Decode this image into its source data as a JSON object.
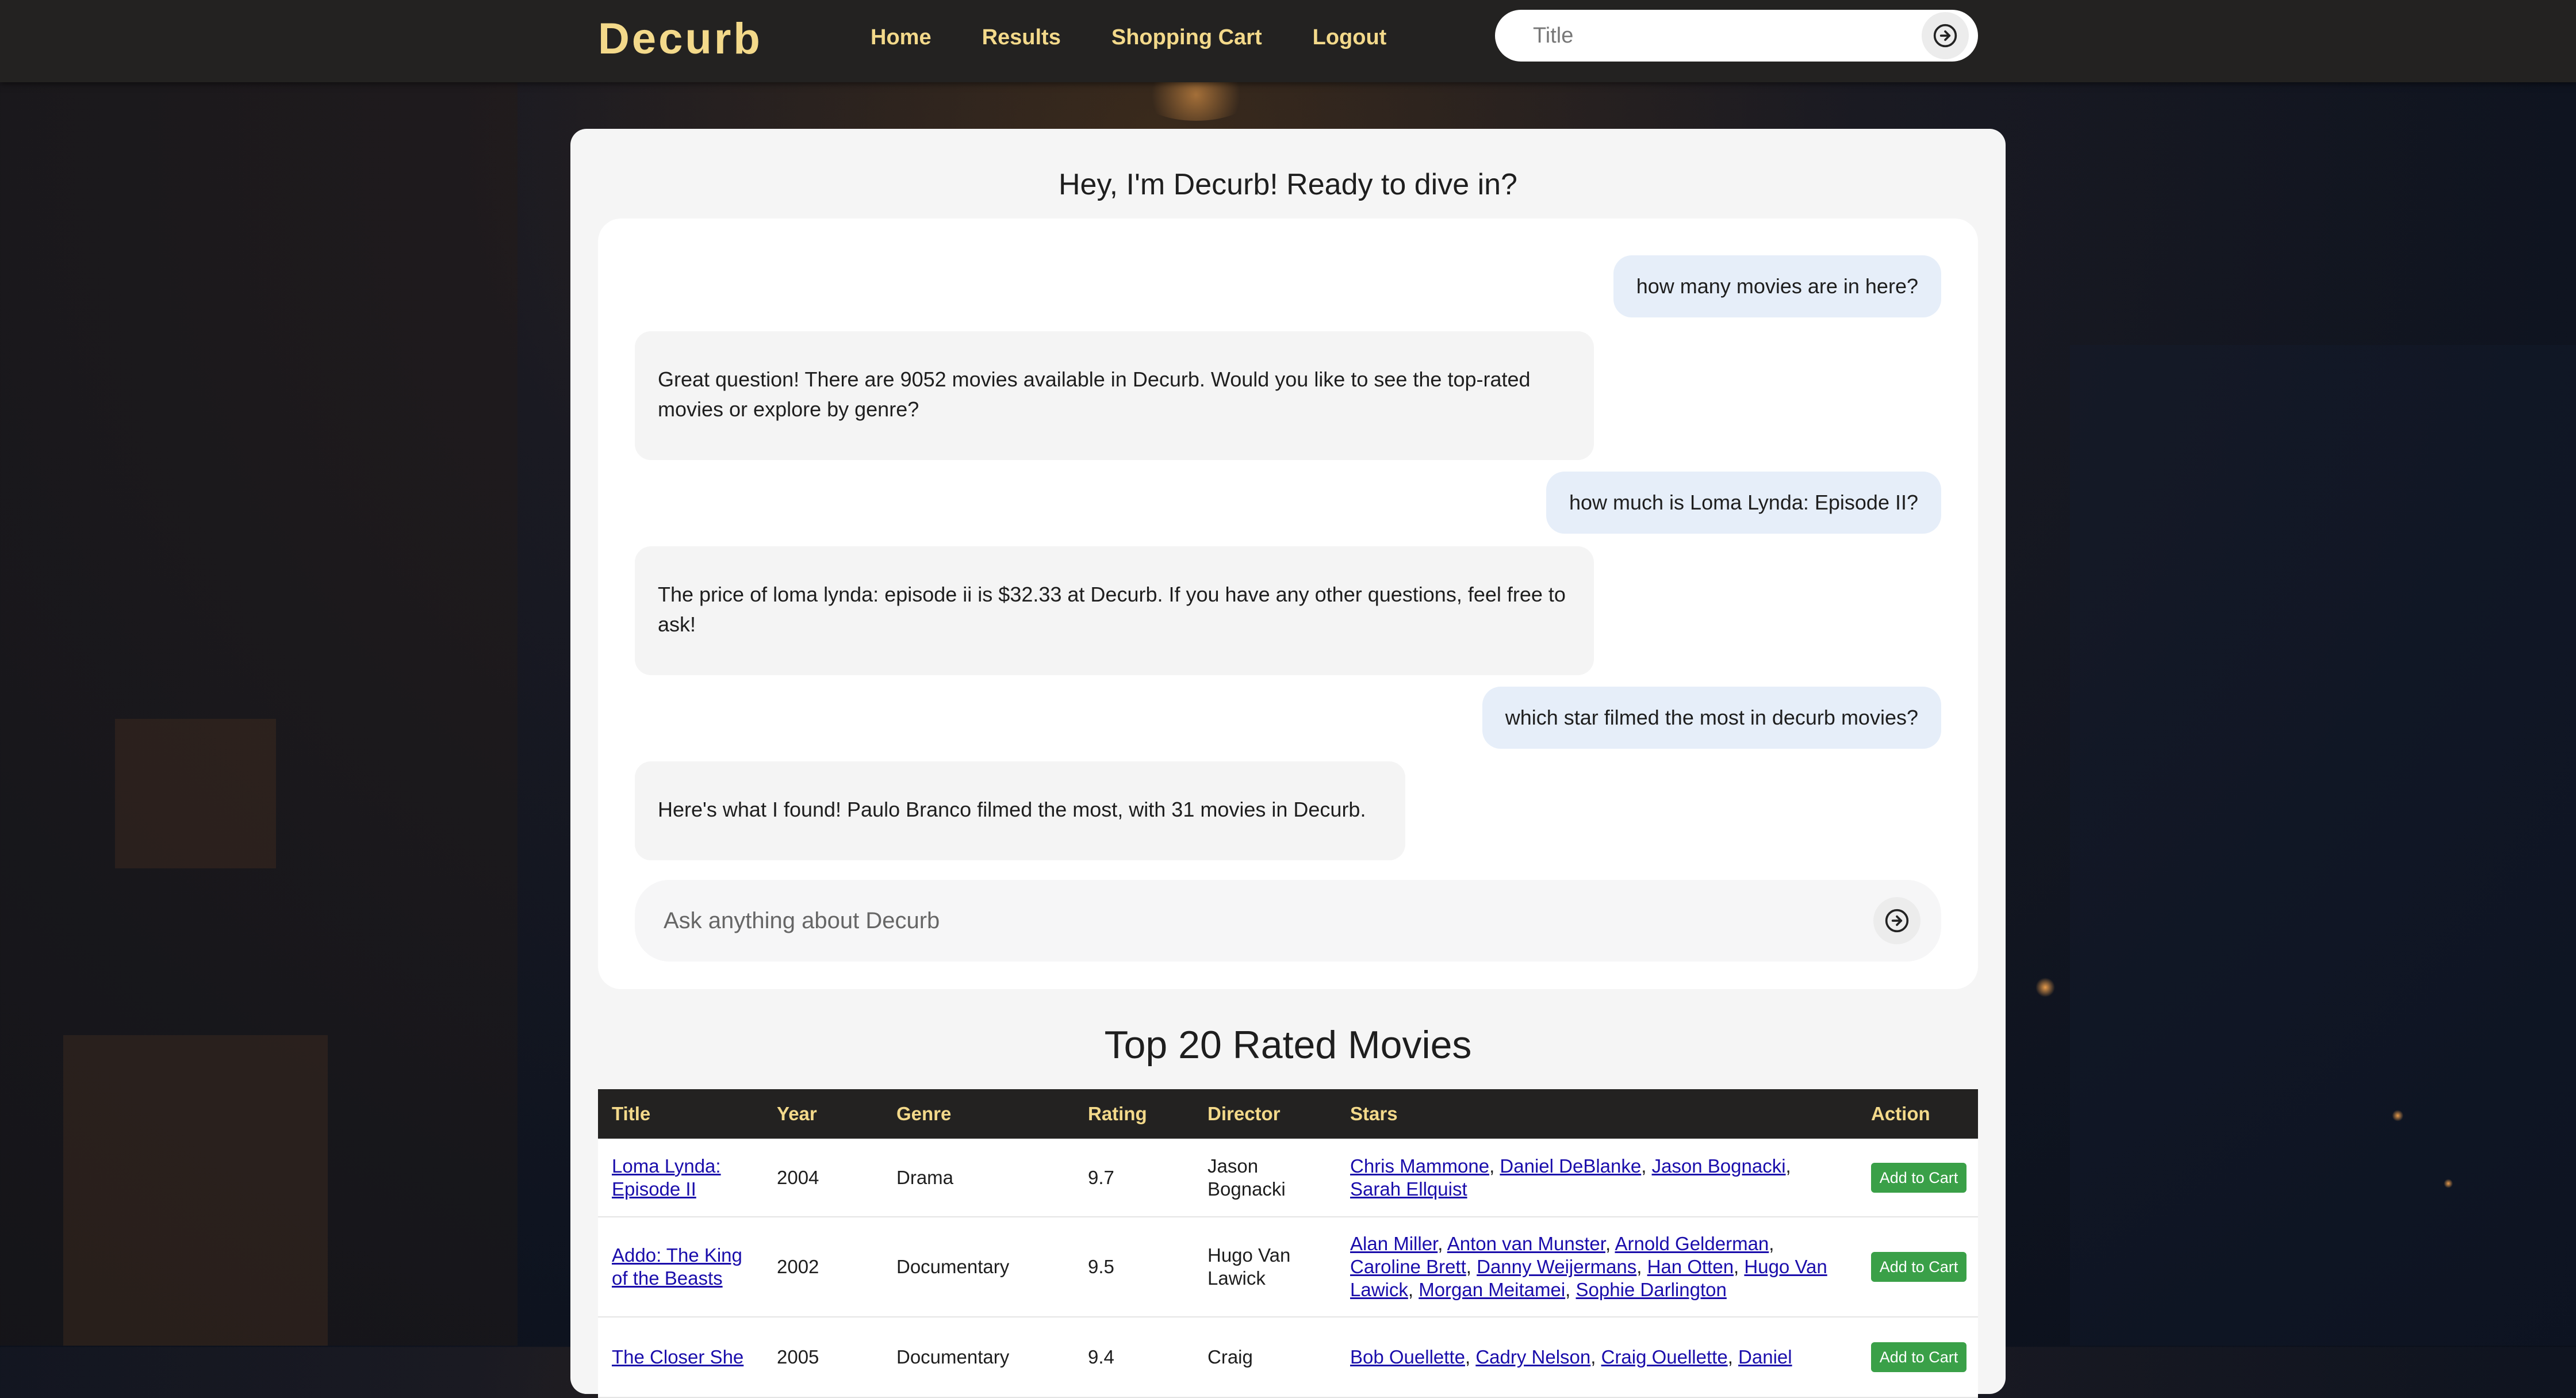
{
  "header": {
    "brand": "Decurb",
    "nav": [
      "Home",
      "Results",
      "Shopping Cart",
      "Logout"
    ],
    "search_placeholder": "Title"
  },
  "chat": {
    "heading": "Hey, I'm Decurb! Ready to dive in?",
    "messages": [
      {
        "role": "user",
        "text": "how many movies are in here?"
      },
      {
        "role": "bot",
        "text": "Great question! There are 9052 movies available in Decurb. Would you like to see the top-rated movies or explore by genre?"
      },
      {
        "role": "user",
        "text": "how much is Loma Lynda: Episode II?"
      },
      {
        "role": "bot",
        "text": "The price of loma lynda: episode ii is $32.33 at Decurb. If you have any other questions, feel free to ask!"
      },
      {
        "role": "user",
        "text": "which star filmed the most in decurb movies?"
      },
      {
        "role": "bot",
        "text": "Here's what I found! Paulo Branco filmed the most, with 31 movies in Decurb."
      }
    ],
    "input_placeholder": "Ask anything about Decurb"
  },
  "top_movies": {
    "title": "Top 20 Rated Movies",
    "columns": [
      "Title",
      "Year",
      "Genre",
      "Rating",
      "Director",
      "Stars",
      "Action"
    ],
    "action_label": "Add to Cart",
    "rows": [
      {
        "title": "Loma Lynda: Episode II",
        "year": "2004",
        "genre": "Drama",
        "rating": "9.7",
        "director": "Jason Bognacki",
        "stars": [
          "Chris Mammone",
          "Daniel DeBlanke",
          "Jason Bognacki",
          "Sarah Ellquist"
        ]
      },
      {
        "title": "Addo: The King of the Beasts",
        "year": "2002",
        "genre": "Documentary",
        "rating": "9.5",
        "director": "Hugo Van Lawick",
        "stars": [
          "Alan Miller",
          "Anton van Munster",
          "Arnold Gelderman",
          "Caroline Brett",
          "Danny Weijermans",
          "Han Otten",
          "Hugo Van Lawick",
          "Morgan Meitamei",
          "Sophie Darlington"
        ]
      },
      {
        "title": "The Closer She",
        "year": "2005",
        "genre": "Documentary",
        "rating": "9.4",
        "director": "Craig",
        "stars": [
          "Bob Ouellette",
          "Cadry Nelson",
          "Craig Ouellette",
          "Daniel"
        ]
      }
    ]
  }
}
